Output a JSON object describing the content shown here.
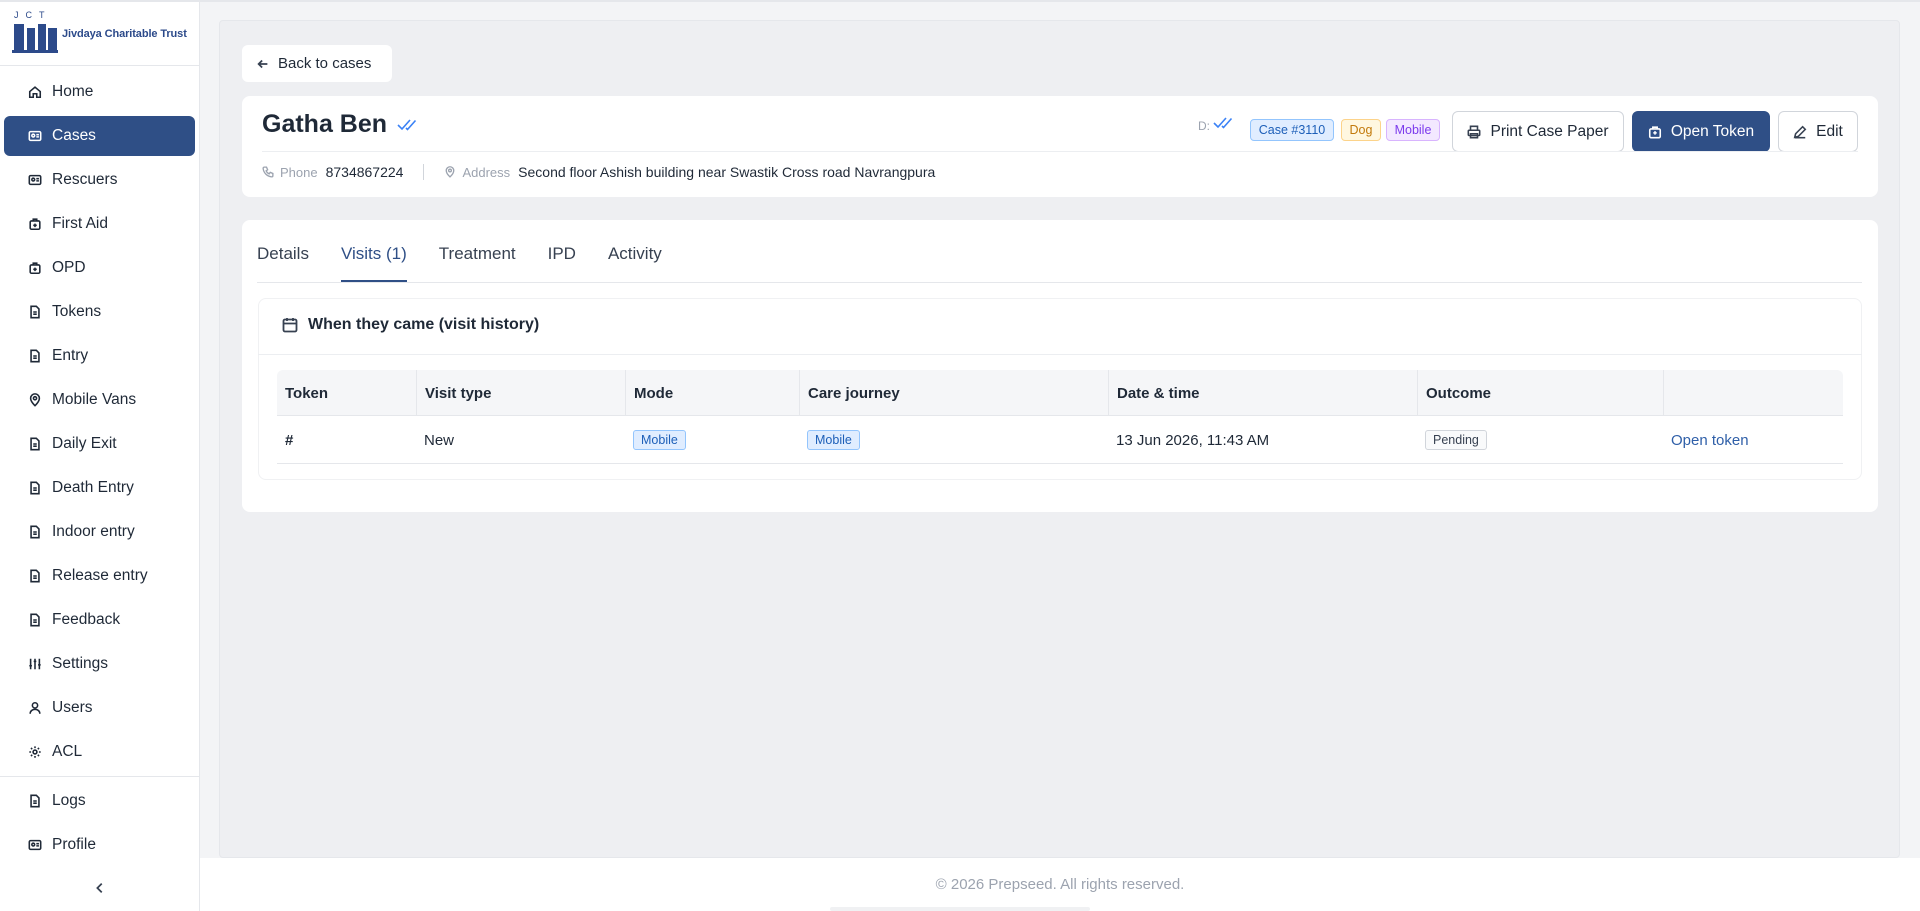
{
  "brand": {
    "name": "Jivdaya Charitable Trust",
    "initials": "JCT"
  },
  "nav": [
    {
      "label": "Home",
      "icon": "home-icon",
      "active": false
    },
    {
      "label": "Cases",
      "icon": "cases-icon",
      "active": true
    },
    {
      "label": "Rescuers",
      "icon": "rescuers-icon",
      "active": false
    },
    {
      "label": "First Aid",
      "icon": "first-aid-icon",
      "active": false
    },
    {
      "label": "OPD",
      "icon": "opd-icon",
      "active": false
    },
    {
      "label": "Tokens",
      "icon": "tokens-icon",
      "active": false
    },
    {
      "label": "Entry",
      "icon": "entry-icon",
      "active": false
    },
    {
      "label": "Mobile Vans",
      "icon": "map-pin-icon",
      "active": false
    },
    {
      "label": "Daily Exit",
      "icon": "daily-exit-icon",
      "active": false
    },
    {
      "label": "Death Entry",
      "icon": "death-entry-icon",
      "active": false
    },
    {
      "label": "Indoor entry",
      "icon": "indoor-entry-icon",
      "active": false
    },
    {
      "label": "Release entry",
      "icon": "release-entry-icon",
      "active": false
    },
    {
      "label": "Feedback",
      "icon": "feedback-icon",
      "active": false
    },
    {
      "label": "Settings",
      "icon": "sliders-icon",
      "active": false
    },
    {
      "label": "Users",
      "icon": "user-icon",
      "active": false
    },
    {
      "label": "ACL",
      "icon": "gear-icon",
      "active": false
    }
  ],
  "nav_bottom": [
    {
      "label": "Logs",
      "icon": "file-icon"
    },
    {
      "label": "Profile",
      "icon": "id-card-icon"
    }
  ],
  "back_label": "Back to cases",
  "case": {
    "name": "Gatha Ben",
    "d_label": "D:",
    "case_badge": "Case #3110",
    "species_badge": "Dog",
    "mode_badge": "Mobile",
    "phone_label": "Phone",
    "phone": "8734867224",
    "address_label": "Address",
    "address": "Second floor Ashish building near Swastik Cross road Navrangpura"
  },
  "actions": {
    "print": "Print Case Paper",
    "open_token": "Open Token",
    "edit": "Edit"
  },
  "tabs": [
    {
      "label": "Details",
      "active": false
    },
    {
      "label": "Visits (1)",
      "active": true
    },
    {
      "label": "Treatment",
      "active": false
    },
    {
      "label": "IPD",
      "active": false
    },
    {
      "label": "Activity",
      "active": false
    }
  ],
  "visits": {
    "title": "When they came (visit history)",
    "columns": [
      "Token",
      "Visit type",
      "Mode",
      "Care journey",
      "Date & time",
      "Outcome",
      ""
    ],
    "rows": [
      {
        "token": "#",
        "visit_type": "New",
        "mode": "Mobile",
        "care_journey": "Mobile",
        "date_time": "13 Jun 2026, 11:43 AM",
        "outcome": "Pending",
        "action": "Open token"
      }
    ]
  },
  "footer": "© 2026 Prepseed. All rights reserved.",
  "colors": {
    "primary": "#2f4f86",
    "background": "#eeeff2",
    "badge_blue": "#1d5fb8",
    "badge_orange": "#c2790a",
    "badge_purple": "#7c3aed"
  }
}
